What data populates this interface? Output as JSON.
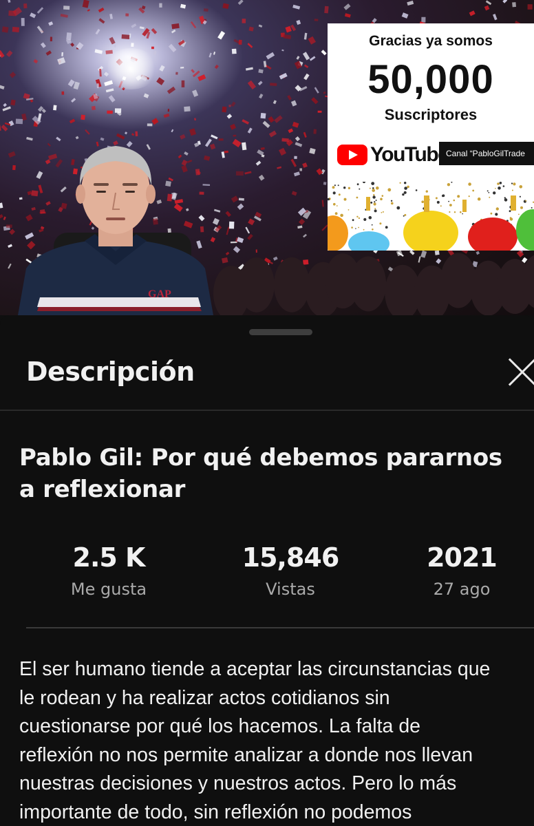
{
  "video": {
    "banner": {
      "line1": "Gracias ya somos",
      "number": "50,000",
      "line2": "Suscriptores",
      "platform": "YouTube",
      "channel_tag": "Canal “PabloGilTrade"
    },
    "shirt_logo": "GAP"
  },
  "sheet": {
    "title": "Descripción",
    "video_title": "Pablo Gil: Por qué debemos pararnos a reflexionar",
    "stats": [
      {
        "value": "2.5 K",
        "label": "Me gusta"
      },
      {
        "value": "15,846",
        "label": "Vistas"
      },
      {
        "value": "2021",
        "label": "27 ago"
      }
    ],
    "description_lines": [
      "El ser humano tiende a aceptar las circunstancias que",
      "le rodean y ha realizar actos cotidianos sin",
      "cuestionarse por qué los hacemos. La falta de",
      "reflexión no nos permite analizar a donde nos llevan",
      "nuestras decisiones y nuestros actos. Pero lo más",
      "importante de todo, sin reflexión no podemos"
    ]
  },
  "colors": {
    "background": "#0f0f0f",
    "youtube_red": "#ff0000",
    "secondary_text": "#aaaaaa"
  }
}
